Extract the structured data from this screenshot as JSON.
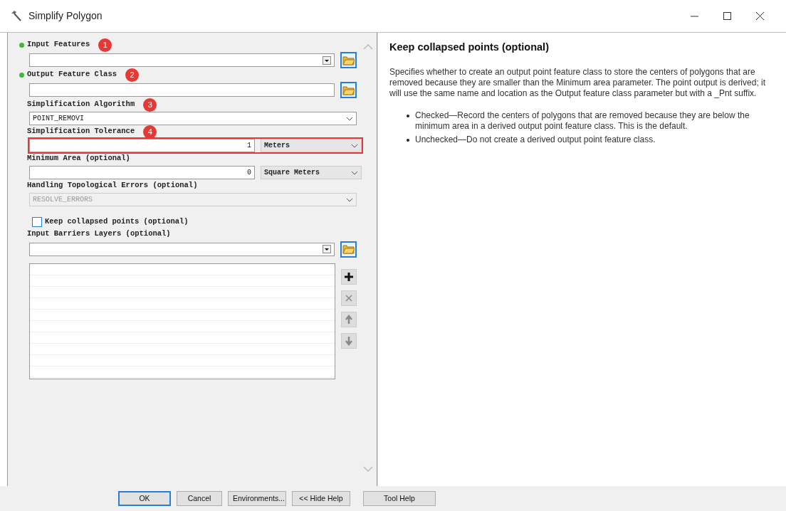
{
  "window": {
    "title": "Simplify Polygon"
  },
  "parameters": [
    {
      "kind": "combo-browse",
      "label": "Input Features",
      "required": true,
      "badge": "1"
    },
    {
      "kind": "text-browse",
      "label": "Output Feature Class",
      "required": true,
      "badge": "2"
    },
    {
      "kind": "dropdown",
      "label": "Simplification Algorithm",
      "required": false,
      "disabled": false,
      "value": "POINT_REMOVI",
      "badge": "3"
    },
    {
      "kind": "value-unit",
      "label": "Simplification Tolerance",
      "required": false,
      "highlighted": true,
      "value": "1",
      "unit": "Meters",
      "badge": "4"
    },
    {
      "kind": "value-unit",
      "label": "Minimum Area (optional)",
      "required": false,
      "highlighted": false,
      "value": "0",
      "unit": "Square Meters"
    },
    {
      "kind": "dropdown",
      "label": "Handling Topological Errors (optional)",
      "required": false,
      "disabled": true,
      "value": "RESOLVE_ERRORS"
    },
    {
      "kind": "checkbox",
      "label": "Keep collapsed points (optional)",
      "checked": false
    },
    {
      "kind": "multi-value",
      "label": "Input Barriers Layers (optional)",
      "required": false
    }
  ],
  "help": {
    "title": "Keep collapsed points (optional)",
    "text": "Specifies whether to create an output point feature class to store the centers of polygons that are removed because they are smaller than the Minimum area parameter. The point output is derived; it will use the same name and location as the Output feature class parameter but with a _Pnt suffix.",
    "bullets": [
      "Checked—Record the centers of polygons that are removed because they are below the minimum area in a derived output point feature class. This is the default.",
      "Unchecked—Do not create a derived output point feature class."
    ]
  },
  "buttons": [
    {
      "label": "OK",
      "default": true
    },
    {
      "label": "Cancel",
      "default": false
    },
    {
      "label": "Environments...",
      "default": false
    },
    {
      "label": "<< Hide Help",
      "default": false
    },
    {
      "label": "Tool Help",
      "default": false
    }
  ]
}
